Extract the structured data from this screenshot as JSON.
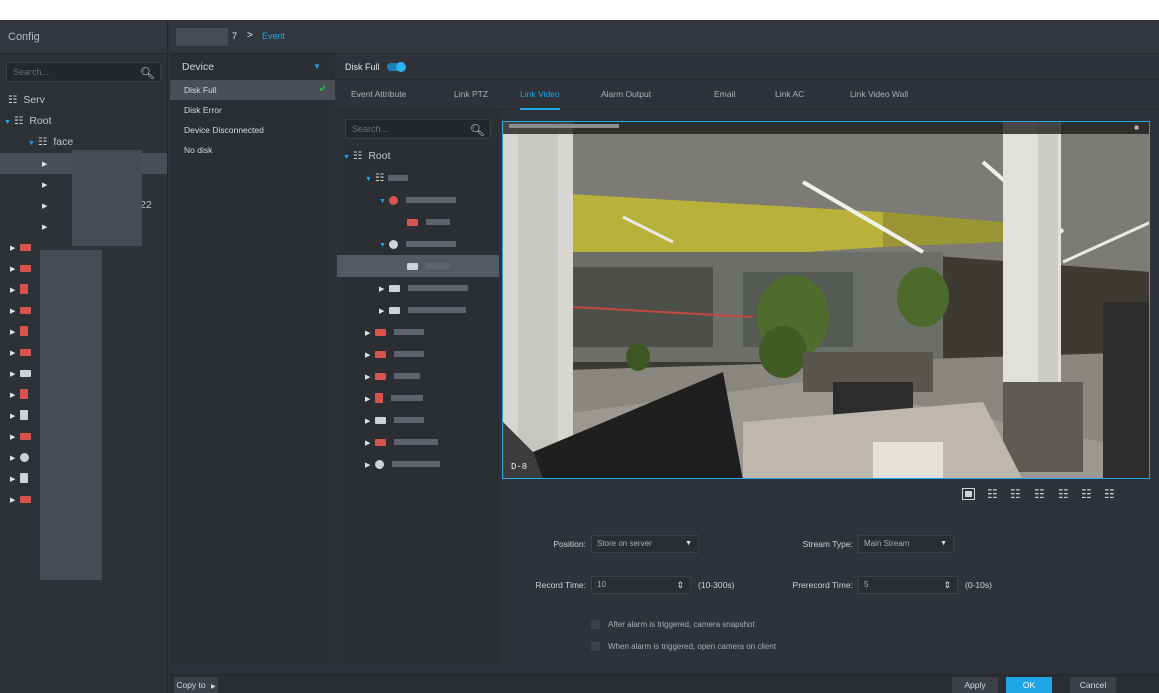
{
  "left_panel": {
    "title": "Config",
    "search_placeholder": "Search...",
    "items": [
      {
        "label": "Serv",
        "icon": "server-icon"
      },
      {
        "label": "Root",
        "icon": "org-icon"
      },
      {
        "label": "face",
        "icon": "org-icon"
      },
      {
        "label": "22",
        "icon": ""
      }
    ]
  },
  "breadcrumb": {
    "part1": "7",
    "separator": ">",
    "current": "Event"
  },
  "event_panel": {
    "header": "Device",
    "items": [
      "Disk Full",
      "Disk Error",
      "Device Disconnected",
      "No disk"
    ],
    "selected": "Disk Full"
  },
  "disk_full": {
    "label": "Disk Full",
    "enabled": true
  },
  "tabs": [
    "Event Attribute",
    "Link PTZ",
    "Link Video",
    "Alarm Output",
    "Email",
    "Link AC",
    "Link Video Wall"
  ],
  "active_tab": "Link Video",
  "sub_tree": {
    "search_placeholder": "Search...",
    "root_label": "Root"
  },
  "video": {
    "overlay_label": "D-8"
  },
  "form": {
    "position_label": "Position:",
    "position_value": "Store on server",
    "stream_type_label": "Stream Type:",
    "stream_type_value": "Main Stream",
    "record_time_label": "Record Time:",
    "record_time_value": "10",
    "record_time_hint": "(10-300s)",
    "prerecord_time_label": "Prerecord Time:",
    "prerecord_time_value": "5",
    "prerecord_time_hint": "(0-10s)",
    "checkbox1": "After alarm is triggered, camera snapshot",
    "checkbox2": "When alarm is triggered, open camera on client"
  },
  "footer": {
    "copy_to": "Copy to",
    "apply": "Apply",
    "ok": "OK",
    "cancel": "Cancel"
  },
  "colors": {
    "accent": "#1ea6e8",
    "check": "#2fbb4f",
    "background": "#2f3238"
  }
}
